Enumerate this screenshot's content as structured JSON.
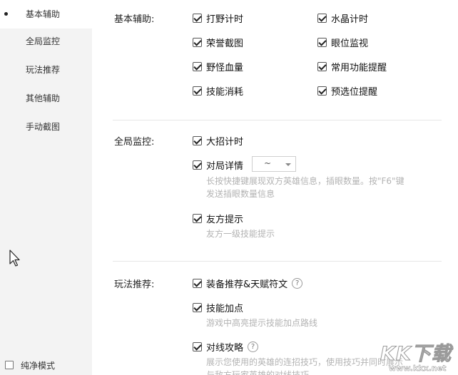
{
  "sidebar": {
    "items": [
      {
        "label": "基本辅助",
        "active": true
      },
      {
        "label": "全局监控",
        "active": false
      },
      {
        "label": "玩法推荐",
        "active": false
      },
      {
        "label": "其他辅助",
        "active": false
      },
      {
        "label": "手动截图",
        "active": false
      }
    ],
    "pure_mode_label": "纯净模式",
    "pure_mode_checked": false
  },
  "sections": {
    "basic": {
      "label": "基本辅助:",
      "options": [
        {
          "label": "打野计时",
          "checked": true
        },
        {
          "label": "水晶计时",
          "checked": true
        },
        {
          "label": "荣誉截图",
          "checked": true
        },
        {
          "label": "眼位监视",
          "checked": true
        },
        {
          "label": "野怪血量",
          "checked": true
        },
        {
          "label": "常用功能提醒",
          "checked": true
        },
        {
          "label": "技能消耗",
          "checked": true
        },
        {
          "label": "预选位提醒",
          "checked": true
        }
      ]
    },
    "global": {
      "label": "全局监控:",
      "ult_timer": {
        "label": "大招计时",
        "checked": true
      },
      "match_detail": {
        "label": "对局详情",
        "checked": true,
        "select_value": "~",
        "desc_line1": "长按快捷键展现双方英雄信息，插眼数量。按\"F6\"键",
        "desc_line2": "发送插眼数量信息"
      },
      "ally_hint": {
        "label": "友方提示",
        "checked": true,
        "desc": "友方一级技能提示"
      }
    },
    "play": {
      "label": "玩法推荐:",
      "equip": {
        "label": "装备推荐&天赋符文",
        "checked": true,
        "help": "?"
      },
      "skill_points": {
        "label": "技能加点",
        "checked": true,
        "desc": "游戏中高亮提示技能加点路线"
      },
      "lane_guide": {
        "label": "对线攻略",
        "checked": true,
        "help": "?",
        "desc_line1": "展示您使用的英雄的连招技巧，使用技巧并同时展示",
        "desc_line2": "与敌方玩家英雄的对线技巧"
      }
    }
  },
  "watermark": {
    "text": "KK下载",
    "url": "www.kkx.net"
  }
}
